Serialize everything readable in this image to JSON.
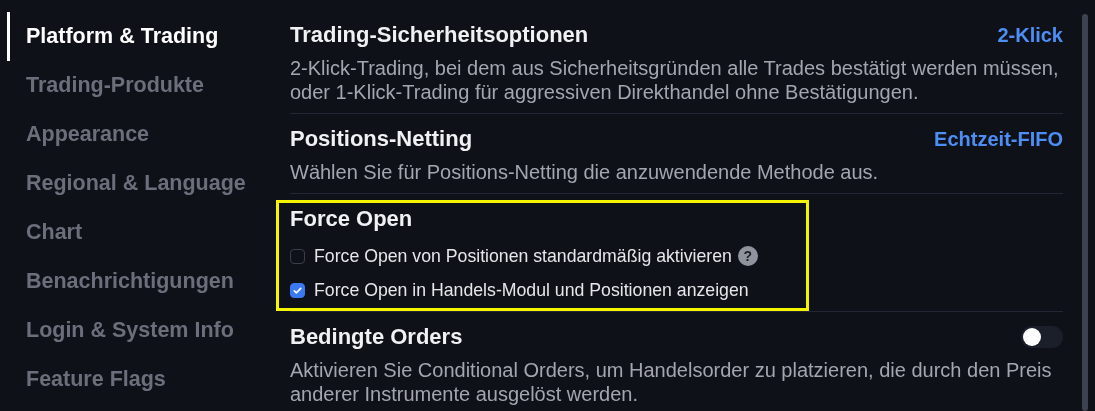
{
  "sidebar": {
    "items": [
      {
        "label": "Platform & Trading",
        "selected": true
      },
      {
        "label": "Trading-Produkte",
        "selected": false
      },
      {
        "label": "Appearance",
        "selected": false
      },
      {
        "label": "Regional & Language",
        "selected": false
      },
      {
        "label": "Chart",
        "selected": false
      },
      {
        "label": "Benachrichtigungen",
        "selected": false
      },
      {
        "label": "Login & System Info",
        "selected": false
      },
      {
        "label": "Feature Flags",
        "selected": false
      }
    ]
  },
  "sections": [
    {
      "kind": "value",
      "title": "Trading-Sicherheitsoptionen",
      "value": "2-Klick",
      "description": "2-Klick-Trading, bei dem aus Sicherheitsgründen alle Trades bestätigt werden müssen, oder 1-Klick-Trading für aggressiven Direkthandel ohne Bestätigungen.",
      "highlighted": false
    },
    {
      "kind": "value",
      "title": "Positions-Netting",
      "value": "Echtzeit-FIFO",
      "description": "Wählen Sie für Positions-Netting die anzuwendende Methode aus.",
      "highlighted": false
    },
    {
      "kind": "checkboxes",
      "title": "Force Open",
      "highlighted": true,
      "options": [
        {
          "label": "Force Open von Positionen standardmäßig aktivieren",
          "checked": false,
          "help_icon": "?"
        },
        {
          "label": "Force Open in Handels-Modul und Positionen anzeigen",
          "checked": true
        }
      ]
    },
    {
      "kind": "toggle",
      "title": "Bedingte Orders",
      "on": false,
      "description": "Aktivieren Sie Conditional Orders, um Handelsorder zu platzieren, die durch den Preis anderer Instrumente ausgelöst werden.",
      "highlighted": false
    }
  ]
}
